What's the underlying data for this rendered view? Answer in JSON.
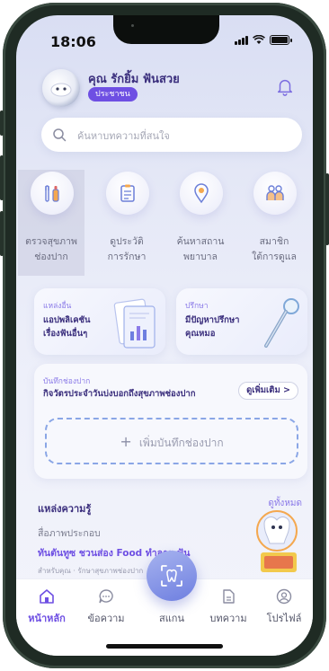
{
  "status_bar": {
    "time": "18:06"
  },
  "header": {
    "user_name": "คุณ รักยิ้ม ฟันสวย",
    "badge": "ประชาชน",
    "bell_icon": "bell-icon"
  },
  "search": {
    "placeholder": "ค้นหาบทความที่สนใจ"
  },
  "quick_menu": [
    {
      "line1": "ตรวจสุขภาพ",
      "line2": "ช่องปาก",
      "icon": "toothbrush-icon"
    },
    {
      "line1": "ดูประวัติ",
      "line2": "การรักษา",
      "icon": "clipboard-icon"
    },
    {
      "line1": "ค้นหาสถาน",
      "line2": "พยาบาล",
      "icon": "location-pin-icon"
    },
    {
      "line1": "สมาชิก",
      "line2": "ใต้การดูแล",
      "icon": "family-icon"
    }
  ],
  "cards": [
    {
      "tag": "แหล่งอื่น",
      "line1": "แอปพลิเคชัน",
      "line2": "เรื่องฟันอื่นๆ"
    },
    {
      "tag": "ปรึกษา",
      "line1": "มีปัญหาปรึกษา",
      "line2": "คุณหมอ"
    }
  ],
  "record": {
    "tag": "บันทึกช่องปาก",
    "title": "กิจวัตรประจำวันบ่งบอกถึงสุขภาพช่องปาก",
    "see_more": "ดูเพิ่มเติม >",
    "add_label": "เพิ่มบันทึกช่องปาก"
  },
  "knowledge": {
    "title": "แหล่งความรู้",
    "see_all": "ดูทั้งหมด",
    "subtitle": "สื่อภาพประกอบ",
    "article_title": "ทันตันทูซ ชวนส่อง Food ทำลาย ฟัน",
    "article_meta": "สำหรับคุณ · รักษาสุขภาพช่องปาก"
  },
  "nav": [
    {
      "label": "หน้าหลัก",
      "icon": "home-icon",
      "active": true
    },
    {
      "label": "ข้อความ",
      "icon": "chat-icon",
      "active": false
    },
    {
      "label": "สแกน",
      "icon": "scan-tooth-icon",
      "active": false
    },
    {
      "label": "บทความ",
      "icon": "document-icon",
      "active": false
    },
    {
      "label": "โปรไฟล์",
      "icon": "profile-icon",
      "active": false
    }
  ],
  "colors": {
    "accent": "#6e4fe3",
    "text_dark": "#3b2f7d",
    "dashed": "#8aa6e6"
  }
}
